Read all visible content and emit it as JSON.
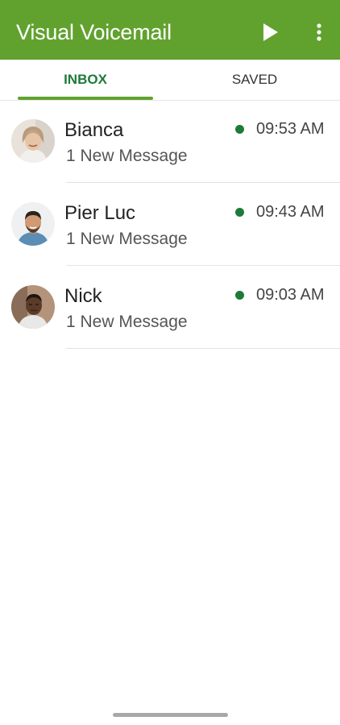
{
  "header": {
    "title": "Visual Voicemail",
    "play_icon": "play-icon",
    "more_icon": "more-vertical-icon",
    "background_color": "#61a22f"
  },
  "tabs": [
    {
      "label": "INBOX",
      "active": true
    },
    {
      "label": "SAVED",
      "active": false
    }
  ],
  "messages": [
    {
      "name": "Bianca",
      "subtitle": "1 New Message",
      "time": "09:53 AM",
      "unread": true
    },
    {
      "name": "Pier Luc",
      "subtitle": "1 New Message",
      "time": "09:43 AM",
      "unread": true
    },
    {
      "name": "Nick",
      "subtitle": "1 New Message",
      "time": "09:03 AM",
      "unread": true
    }
  ],
  "colors": {
    "accent_green": "#1e7a3a",
    "tab_indicator": "#61a22f"
  }
}
